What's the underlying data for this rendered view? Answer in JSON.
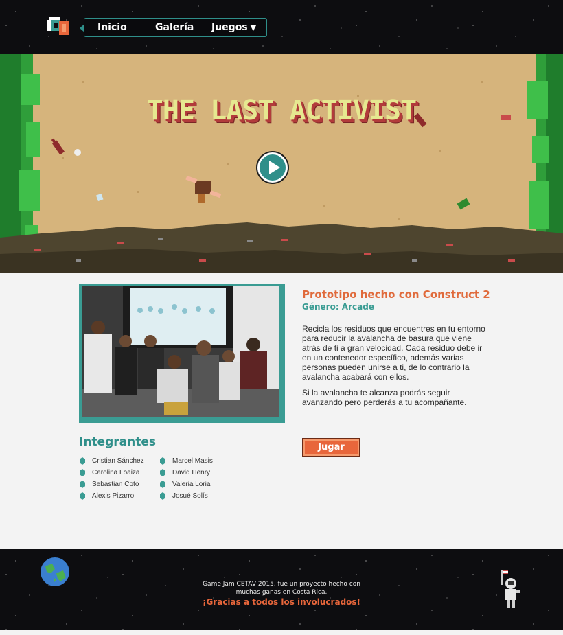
{
  "nav": {
    "items": [
      {
        "label": "Inicio"
      },
      {
        "label": "Galería"
      },
      {
        "label": "Juegos"
      }
    ],
    "dropdown_glyph": "▼"
  },
  "hero": {
    "title": "THE LAST ACTIVIST",
    "play_icon": "play-icon"
  },
  "info": {
    "title": "Prototipo hecho con Construct 2",
    "genre": "Género: Arcade",
    "paragraph1": "Recicla los residuos que encuentres en tu entorno para reducir la avalancha de basura que viene atrás de ti a gran velocidad. Cada residuo debe ir en un contenedor específico, además varias personas pueden unirse a ti, de lo contrario la avalancha acabará con ellos.",
    "paragraph2": "Si la avalancha te alcanza podrás seguir avanzando pero perderás a tu acompañante.",
    "play_button": "Jugar"
  },
  "members": {
    "title": "Integrantes",
    "col1": [
      "Cristian Sánchez",
      "Carolina Loaiza",
      "Sebastian Coto",
      "Alexis Pizarro"
    ],
    "col2": [
      "Marcel Masis",
      "David Henry",
      "Valeria Loria",
      "Josué Solís"
    ]
  },
  "footer": {
    "line1": "Game Jam CETAV 2015, fue un proyecto hecho con",
    "line2": "muchas ganas en Costa Rica.",
    "thanks": "¡Gracias a todos los involucrados!"
  },
  "colors": {
    "accent_teal": "#2f8f8a",
    "accent_orange": "#e8663b",
    "sand": "#d6b47c",
    "space": "#0d0d10"
  }
}
